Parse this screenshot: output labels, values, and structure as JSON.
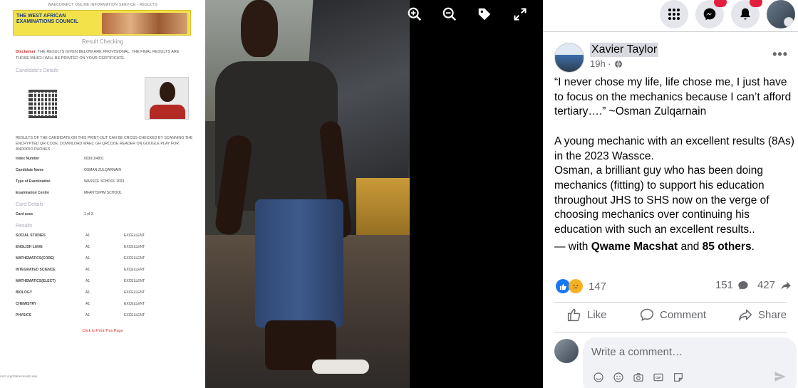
{
  "viewer": {
    "controls": [
      "zoom-in-icon",
      "zoom-out-icon",
      "tag-icon",
      "fullscreen-icon"
    ]
  },
  "document": {
    "top_line": "WAECDIRECT ONLINE INFORMATION SERVICE - RESULTS",
    "logo_text": "THE WEST AFRICAN EXAMINATIONS COUNCIL",
    "title": "Result Checking",
    "disclaimer_label": "Disclaimer",
    "disclaimer": ": THE RESULTS GIVEN BELOW ARE PROVISIONAL. THE FINAL RESULTS ARE THOSE WHICH WILL BE PRINTED ON YOUR CERTIFICATE.",
    "candidate_details": "Candidate's Details",
    "note": "RESULTS OF THE CANDIDATE ON THIS PRINT-OUT CAN BE CROSS-CHECKED BY SCANNING THE ENCRYPTED QR-CODE. DOWNLOAD WAEC GH QRCODE READER ON GOOGLE PLAY FOR ANDROID PHONES",
    "fields": [
      {
        "k": "Index Number",
        "v": "0030104831"
      },
      {
        "k": "Candidate Name",
        "v": "OSMAN ZULQARNAIN"
      },
      {
        "k": "Type of Examination",
        "v": "WASSCE SCHOOL 2023"
      },
      {
        "k": "Examination Centre",
        "v": "MFANTSIPIM SCHOOL"
      }
    ],
    "card_details": "Card Details",
    "card_use_label": "Card uses",
    "card_use_value": "1 of 3",
    "results_label": "Results",
    "results": [
      {
        "s": "SOCIAL STUDIES",
        "g": "A1",
        "r": "EXCELLENT"
      },
      {
        "s": "ENGLISH LANG",
        "g": "A1",
        "r": "EXCELLENT"
      },
      {
        "s": "MATHEMATICS(CORE)",
        "g": "A1",
        "r": "EXCELLENT"
      },
      {
        "s": "INTEGRATED SCIENCE",
        "g": "A1",
        "r": "EXCELLENT"
      },
      {
        "s": "MATHEMATICS(ELECT)",
        "g": "A1",
        "r": "EXCELLENT"
      },
      {
        "s": "BIOLOGY",
        "g": "A1",
        "r": "EXCELLENT"
      },
      {
        "s": "CHEMISTRY",
        "g": "A1",
        "r": "EXCELLENT"
      },
      {
        "s": "PHYSICS",
        "g": "A1",
        "r": "EXCELLENT"
      }
    ],
    "print_link": "Click to Print This Page",
    "footer_url": "irect.org/Statusresults.asp"
  },
  "topbar": {
    "messenger_badge": "",
    "notif_badge": ""
  },
  "post": {
    "author": "Xavier Taylor",
    "time": "19h ·",
    "paragraphs": [
      "“I never chose my life, life chose me, I just have to focus on the mechanics because I can’t afford tertiary….” ~Osman Zulqarnain",
      "",
      "A young mechanic with an excellent results (8As) in the 2023 Wassce.",
      "Osman, a brilliant guy who has been doing mechanics (fitting) to support his education throughout JHS to SHS now on the verge of choosing mechanics over continuing his education with such an excellent results.."
    ],
    "with_prefix": "— with ",
    "with_person": "Qwame Macshat",
    "with_and": " and ",
    "with_others": "85 others",
    "with_suffix": ".",
    "reactions_count": "147",
    "comments_count": "151",
    "shares_count": "427",
    "like_label": "Like",
    "comment_label": "Comment",
    "share_label": "Share",
    "comment_placeholder": "Write a comment…"
  },
  "colors": {
    "accent": "#1877f2",
    "badge": "#e41e3f",
    "text": "#050505",
    "muted": "#65676b"
  }
}
